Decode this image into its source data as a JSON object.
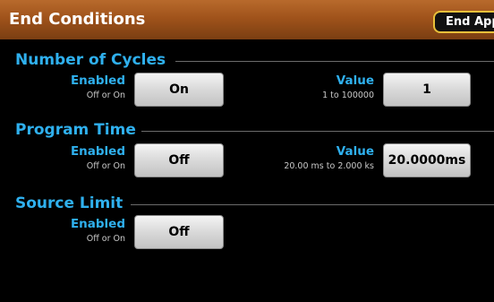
{
  "header": {
    "title": "End Conditions",
    "end_app_label": "End App"
  },
  "sections": {
    "cycles": {
      "title": "Number of Cycles",
      "enabled_label": "Enabled",
      "enabled_hint": "Off or On",
      "enabled_value": "On",
      "value_label": "Value",
      "value_hint": "1 to 100000",
      "value": "1"
    },
    "program_time": {
      "title": "Program Time",
      "enabled_label": "Enabled",
      "enabled_hint": "Off or On",
      "enabled_value": "Off",
      "value_label": "Value",
      "value_hint": "20.00 ms to 2.000 ks",
      "value": "20.0000ms"
    },
    "source_limit": {
      "title": "Source Limit",
      "enabled_label": "Enabled",
      "enabled_hint": "Off or On",
      "enabled_value": "Off"
    }
  },
  "colors": {
    "title_bar": "#a0531b",
    "accent_text": "#2fb0ee",
    "end_app_border": "#e8c03a"
  }
}
